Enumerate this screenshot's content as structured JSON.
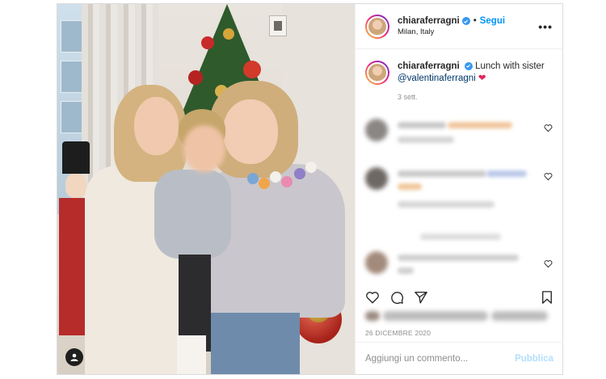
{
  "post": {
    "author": {
      "username": "chiaraferragni",
      "verified": true,
      "follow_label": "Segui",
      "separator": "•",
      "location": "Milan, Italy"
    },
    "more_icon": "more-horizontal-icon",
    "caption": {
      "username": "chiaraferragni",
      "text": "Lunch with sister",
      "mention": "@valentinaferragni",
      "emoji": "❤",
      "time_ago": "3 sett."
    },
    "actions": {
      "like_icon": "heart-outline-icon",
      "comment_icon": "comment-bubble-icon",
      "share_icon": "paper-plane-icon",
      "save_icon": "bookmark-icon"
    },
    "date": "26 DICEMBRE 2020",
    "comment_input": {
      "placeholder": "Aggiungi un commento...",
      "publish_label": "Pubblica"
    }
  },
  "colors": {
    "link_blue": "#0095f6",
    "publish_disabled": "#b2dffc",
    "verified_badge": "#3897f0",
    "muted_text": "#8e8e8e"
  }
}
